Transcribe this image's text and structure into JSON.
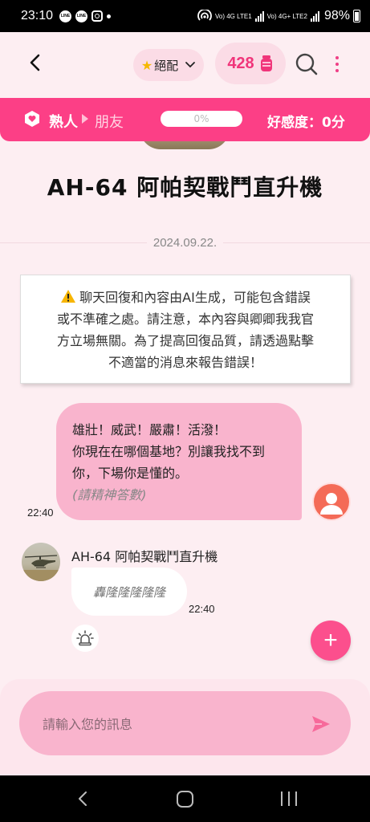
{
  "status_bar": {
    "time": "23:10",
    "line1": "LINE",
    "line2": "LINE",
    "network1": "Vo) 4G LTE1",
    "network2": "Vo) 4G+ LTE2",
    "battery": "98%"
  },
  "header": {
    "rating_label": "絕配",
    "coins": "428"
  },
  "relationship": {
    "current": "熟人",
    "next": "朋友",
    "progress": "0%",
    "progress_value": 0,
    "affinity": "好感度：0分"
  },
  "character": {
    "name": "AH-64 阿帕契戰鬥直升機"
  },
  "chat": {
    "date": "2024.09.22.",
    "notice_line1": "聊天回復和內容由AI生成，可能包含錯誤",
    "notice_line2": "或不準確之處。請注意，本內容與卿卿我我官",
    "notice_line3": "方立場無關。為了提高回復品質，請透過點擊",
    "notice_line4": "不適當的消息來報告錯誤！",
    "user_message": {
      "line1": "雄壯！威武！嚴肅！活潑！",
      "line2": "你現在在哪個基地？別讓我找不到",
      "line3": "你，下場你是懂的。",
      "action": "(請精神答數)",
      "time": "22:40"
    },
    "bot_message": {
      "sender": "AH-64 阿帕契戰鬥直升機",
      "text": "轟隆隆隆隆隆",
      "time": "22:40"
    }
  },
  "composer": {
    "placeholder": "請輸入您的訊息"
  },
  "colors": {
    "accent": "#fc3f86",
    "user_bubble": "#f9b4cd",
    "background": "#fdeef2"
  }
}
